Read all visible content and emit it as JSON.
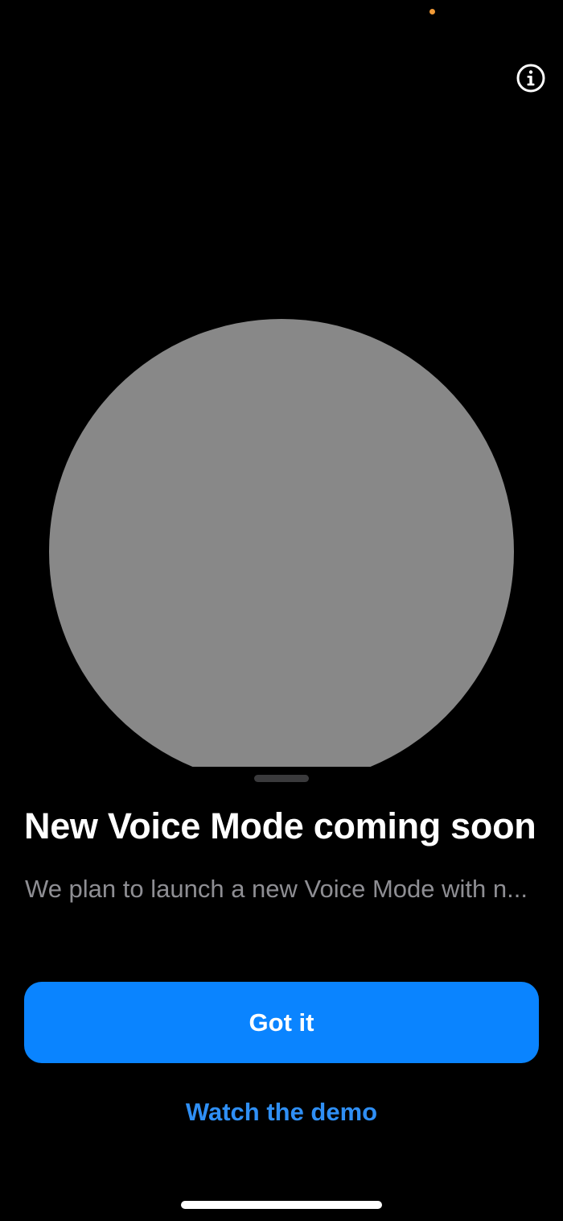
{
  "colors": {
    "background": "#000000",
    "orb": "#888888",
    "accent": "#0a84ff",
    "link": "#2f8ff5",
    "secondary_text": "#8e8e93",
    "privacy_dot": "#f09a37"
  },
  "header": {
    "info_icon": "info-circle-icon"
  },
  "sheet": {
    "title": "New Voice Mode coming soon",
    "description": "We plan to launch a new Voice Mode with n..."
  },
  "actions": {
    "primary_label": "Got it",
    "secondary_label": "Watch the demo"
  }
}
